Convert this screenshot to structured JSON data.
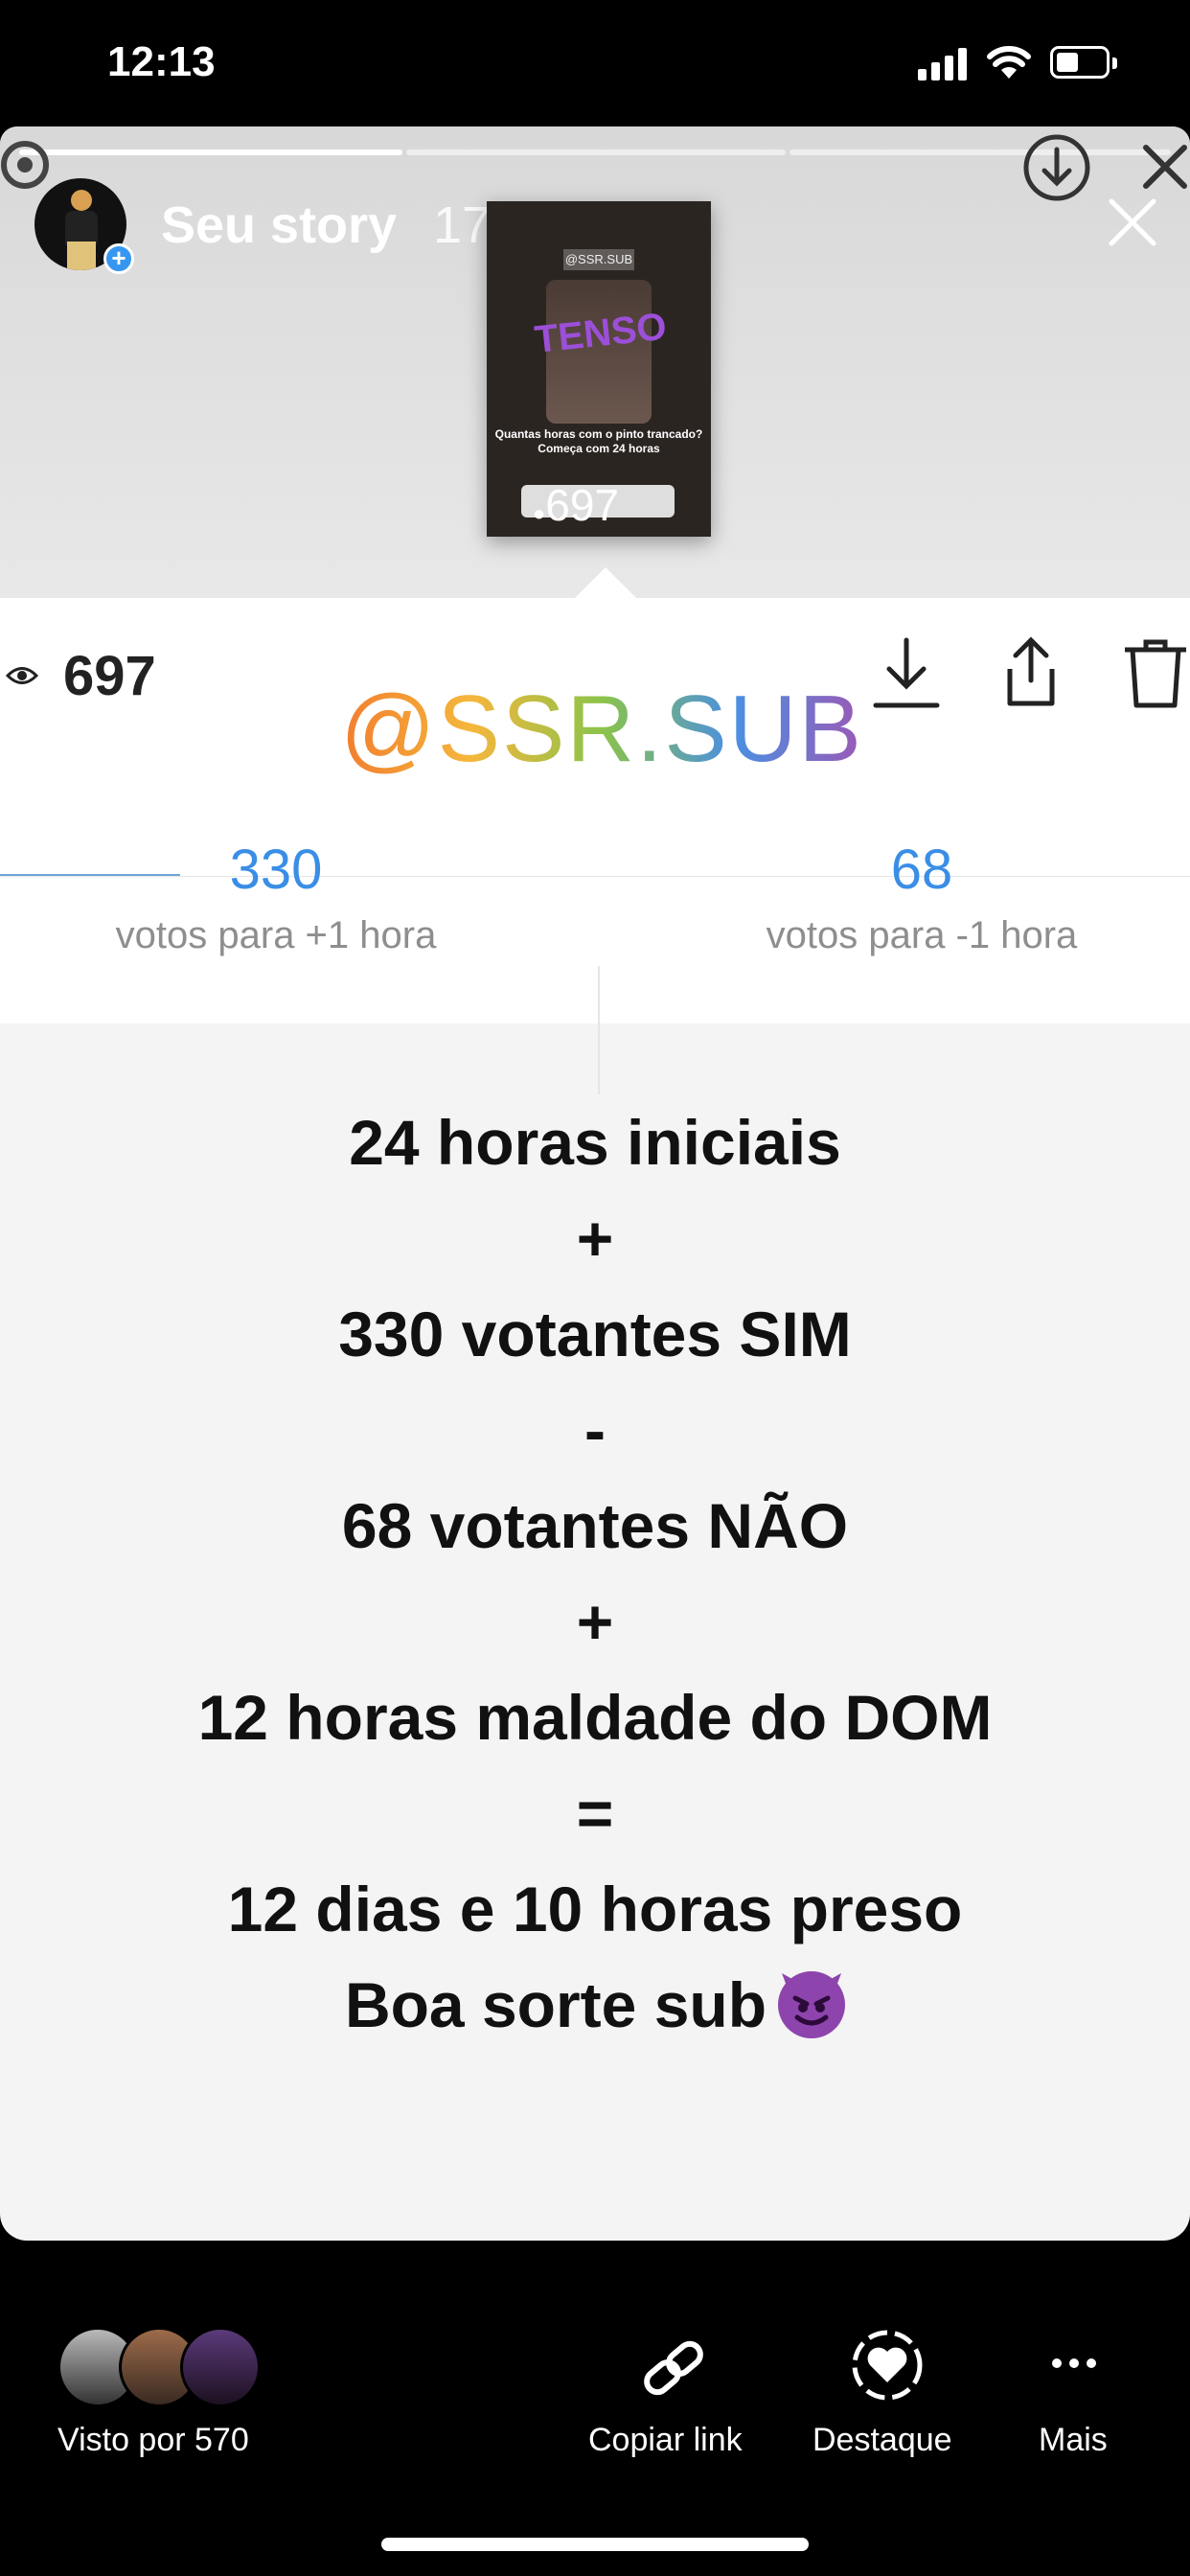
{
  "status_bar": {
    "time": "12:13"
  },
  "story_header": {
    "title": "Seu story",
    "age": "17h"
  },
  "thumbnail": {
    "handle": "@SSR.SUB",
    "word": "TENSO",
    "question": "Quantas horas com o pinto trancado? Começa com 24 horas",
    "views": "697"
  },
  "insights": {
    "views": "697",
    "sticker_handle": "@SSR.SUB"
  },
  "poll": {
    "option1": {
      "count": "330",
      "label": "votos para +1 hora"
    },
    "option2": {
      "count": "68",
      "label": "votos para -1 hora"
    }
  },
  "story_text": {
    "lines": [
      "24 horas iniciais",
      "+",
      "330 votantes SIM",
      "-",
      "68 votantes NÃO",
      "+",
      "12 horas maldade do DOM",
      "=",
      "12 dias e 10 horas preso",
      "Boa sorte sub"
    ]
  },
  "bottom_bar": {
    "seen_by": "Visto por 570",
    "copy_link": "Copiar link",
    "highlight": "Destaque",
    "more": "Mais"
  },
  "colors": {
    "poll_blue": "#3a8ee6",
    "accent_purple": "#8e44ad"
  }
}
